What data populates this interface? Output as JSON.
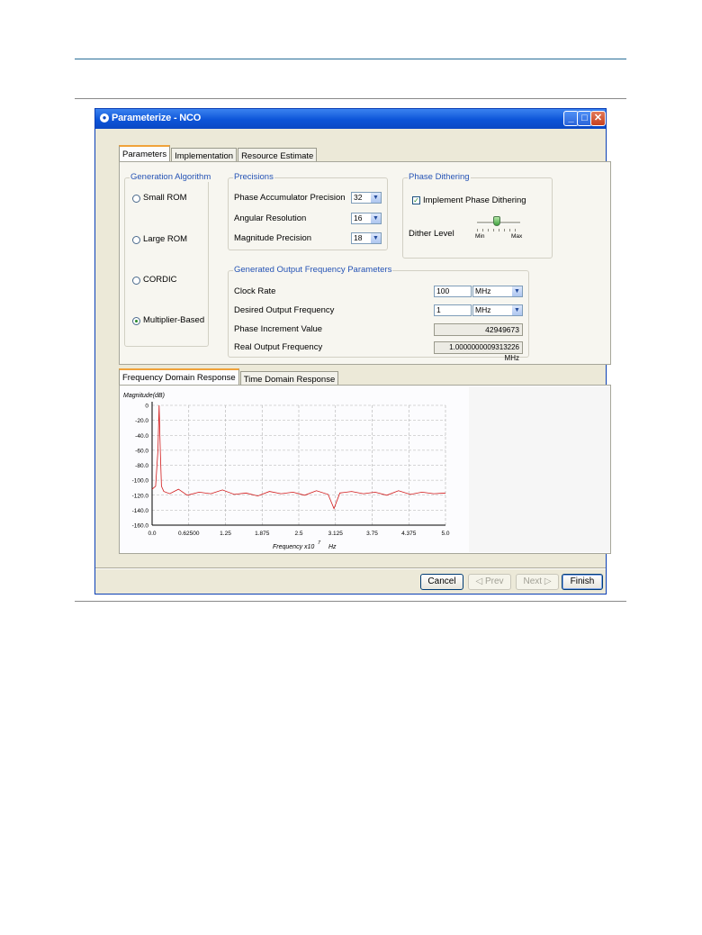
{
  "window": {
    "title": "Parameterize - NCO"
  },
  "tabs": [
    "Parameters",
    "Implementation",
    "Resource Estimate"
  ],
  "generation_algorithm": {
    "title": "Generation Algorithm",
    "options": [
      "Small ROM",
      "Large ROM",
      "CORDIC",
      "Multiplier-Based"
    ],
    "selected": "Multiplier-Based"
  },
  "precisions": {
    "title": "Precisions",
    "phase_accumulator_label": "Phase Accumulator Precision",
    "phase_accumulator_value": "32",
    "angular_resolution_label": "Angular Resolution",
    "angular_resolution_value": "16",
    "magnitude_label": "Magnitude Precision",
    "magnitude_value": "18"
  },
  "phase_dithering": {
    "title": "Phase Dithering",
    "checkbox_label": "Implement Phase Dithering",
    "checked": true,
    "dither_level_label": "Dither Level",
    "min_label": "Min",
    "max_label": "Max",
    "level": 0.45
  },
  "output_frequency": {
    "title": "Generated Output Frequency Parameters",
    "clock_rate_label": "Clock Rate",
    "clock_rate_value": "100",
    "clock_rate_unit": "MHz",
    "desired_label": "Desired Output Frequency",
    "desired_value": "1",
    "desired_unit": "MHz",
    "phase_increment_label": "Phase Increment Value",
    "phase_increment_value": "42949673",
    "real_output_label": "Real Output Frequency",
    "real_output_value": "1.0000000009313226 MHz"
  },
  "response_tabs": [
    "Frequency Domain Response",
    "Time Domain Response"
  ],
  "chart_data": {
    "type": "line",
    "ylabel": "Magnitude(dB)",
    "xlabel": "Frequency x10",
    "xlabel_exp": "7",
    "xlabel_unit": "Hz",
    "xlim": [
      0,
      5
    ],
    "ylim": [
      -160,
      0
    ],
    "x_ticks": [
      "0.0",
      "0.62500",
      "1.25",
      "1.875",
      "2.5",
      "3.125",
      "3.75",
      "4.375",
      "5.0"
    ],
    "y_ticks": [
      "0",
      "-20.0",
      "-40.0",
      "-60.0",
      "-80.0",
      "-100.0",
      "-120.0",
      "-140.0",
      "-160.0"
    ],
    "series": [
      {
        "color": "#d21a1a",
        "x": [
          0.0,
          0.06,
          0.1,
          0.12,
          0.14,
          0.16,
          0.2,
          0.3,
          0.45,
          0.6,
          0.8,
          1.0,
          1.2,
          1.4,
          1.6,
          1.8,
          2.0,
          2.2,
          2.4,
          2.6,
          2.8,
          3.0,
          3.1,
          3.2,
          3.4,
          3.6,
          3.8,
          4.0,
          4.2,
          4.4,
          4.6,
          4.8,
          5.0
        ],
        "y": [
          -112,
          -108,
          -60,
          0,
          -60,
          -108,
          -115,
          -118,
          -112,
          -120,
          -116,
          -118,
          -113,
          -119,
          -117,
          -121,
          -115,
          -118,
          -116,
          -120,
          -114,
          -119,
          -138,
          -117,
          -115,
          -118,
          -116,
          -120,
          -114,
          -119,
          -116,
          -118,
          -117
        ]
      }
    ]
  },
  "buttons": {
    "cancel": "Cancel",
    "prev": "◁ Prev",
    "next": "Next ▷",
    "finish": "Finish"
  }
}
